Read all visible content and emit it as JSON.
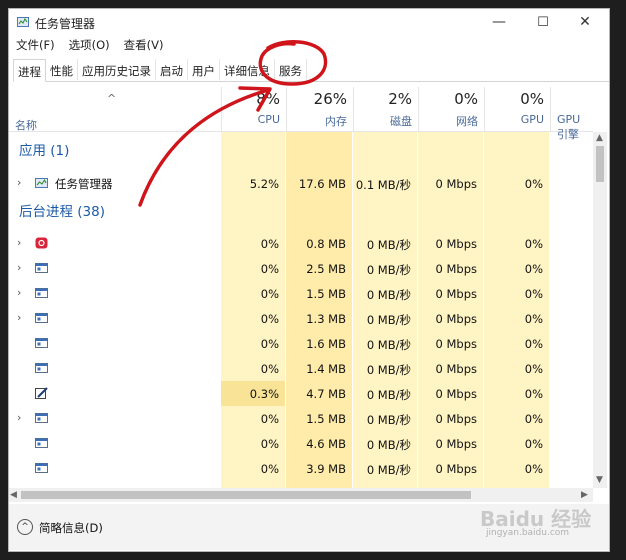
{
  "window": {
    "title": "任务管理器",
    "controls": {
      "minimize": "—",
      "maximize": "☐",
      "close": "✕"
    }
  },
  "menu": [
    "文件(F)",
    "选项(O)",
    "查看(V)"
  ],
  "tabs": [
    {
      "label": "进程",
      "active": true
    },
    {
      "label": "性能"
    },
    {
      "label": "应用历史记录"
    },
    {
      "label": "启动"
    },
    {
      "label": "用户"
    },
    {
      "label": "详细信息"
    },
    {
      "label": "服务"
    }
  ],
  "columns": {
    "name": {
      "label": "名称",
      "sort_glyph": "^"
    },
    "cpu": {
      "pct": "8%",
      "label": "CPU"
    },
    "mem": {
      "pct": "26%",
      "label": "内存"
    },
    "disk": {
      "pct": "2%",
      "label": "磁盘"
    },
    "net": {
      "pct": "0%",
      "label": "网络"
    },
    "gpu": {
      "pct": "0%",
      "label": "GPU"
    },
    "gpu_engine": {
      "label": "GPU 引擎"
    }
  },
  "groups": {
    "apps": "应用 (1)",
    "background": "后台进程 (38)"
  },
  "rows": [
    {
      "name": "任务管理器",
      "cpu": "5.2%",
      "mem": "17.6 MB",
      "disk": "0.1 MB/秒",
      "net": "0 Mbps",
      "gpu": "0%",
      "icon": "task-manager-icon",
      "expand": true
    },
    {
      "name": "",
      "cpu": "0%",
      "mem": "0.8 MB",
      "disk": "0 MB/秒",
      "net": "0 Mbps",
      "gpu": "0%",
      "icon": "red-app-icon",
      "expand": true
    },
    {
      "name": "",
      "cpu": "0%",
      "mem": "2.5 MB",
      "disk": "0 MB/秒",
      "net": "0 Mbps",
      "gpu": "0%",
      "icon": "window-icon",
      "expand": true
    },
    {
      "name": "",
      "cpu": "0%",
      "mem": "1.5 MB",
      "disk": "0 MB/秒",
      "net": "0 Mbps",
      "gpu": "0%",
      "icon": "window-icon",
      "expand": true
    },
    {
      "name": "",
      "cpu": "0%",
      "mem": "1.3 MB",
      "disk": "0 MB/秒",
      "net": "0 Mbps",
      "gpu": "0%",
      "icon": "window-icon",
      "expand": true
    },
    {
      "name": "",
      "cpu": "0%",
      "mem": "1.6 MB",
      "disk": "0 MB/秒",
      "net": "0 Mbps",
      "gpu": "0%",
      "icon": "window-icon",
      "expand": false
    },
    {
      "name": "",
      "cpu": "0%",
      "mem": "1.4 MB",
      "disk": "0 MB/秒",
      "net": "0 Mbps",
      "gpu": "0%",
      "icon": "window-icon",
      "expand": false
    },
    {
      "name": "",
      "cpu": "0.3%",
      "mem": "4.7 MB",
      "disk": "0 MB/秒",
      "net": "0 Mbps",
      "gpu": "0%",
      "icon": "edit-icon",
      "expand": false
    },
    {
      "name": "",
      "cpu": "0%",
      "mem": "1.5 MB",
      "disk": "0 MB/秒",
      "net": "0 Mbps",
      "gpu": "0%",
      "icon": "window-icon",
      "expand": true
    },
    {
      "name": "",
      "cpu": "0%",
      "mem": "4.6 MB",
      "disk": "0 MB/秒",
      "net": "0 Mbps",
      "gpu": "0%",
      "icon": "window-icon",
      "expand": false
    },
    {
      "name": "",
      "cpu": "0%",
      "mem": "3.9 MB",
      "disk": "0 MB/秒",
      "net": "0 Mbps",
      "gpu": "0%",
      "icon": "window-icon",
      "expand": false
    }
  ],
  "footer": {
    "label": "简略信息(D)",
    "icon_glyph": "^"
  },
  "watermark": {
    "logo": "Baidu 经验",
    "url": "jingyan.baidu.com"
  },
  "colors": {
    "heat_light": "#fff4c4",
    "heat_mid": "#ffecaa",
    "heat_strong": "#f9e396",
    "group_blue": "#1d5ba8",
    "annotation_red": "#d0141b"
  }
}
